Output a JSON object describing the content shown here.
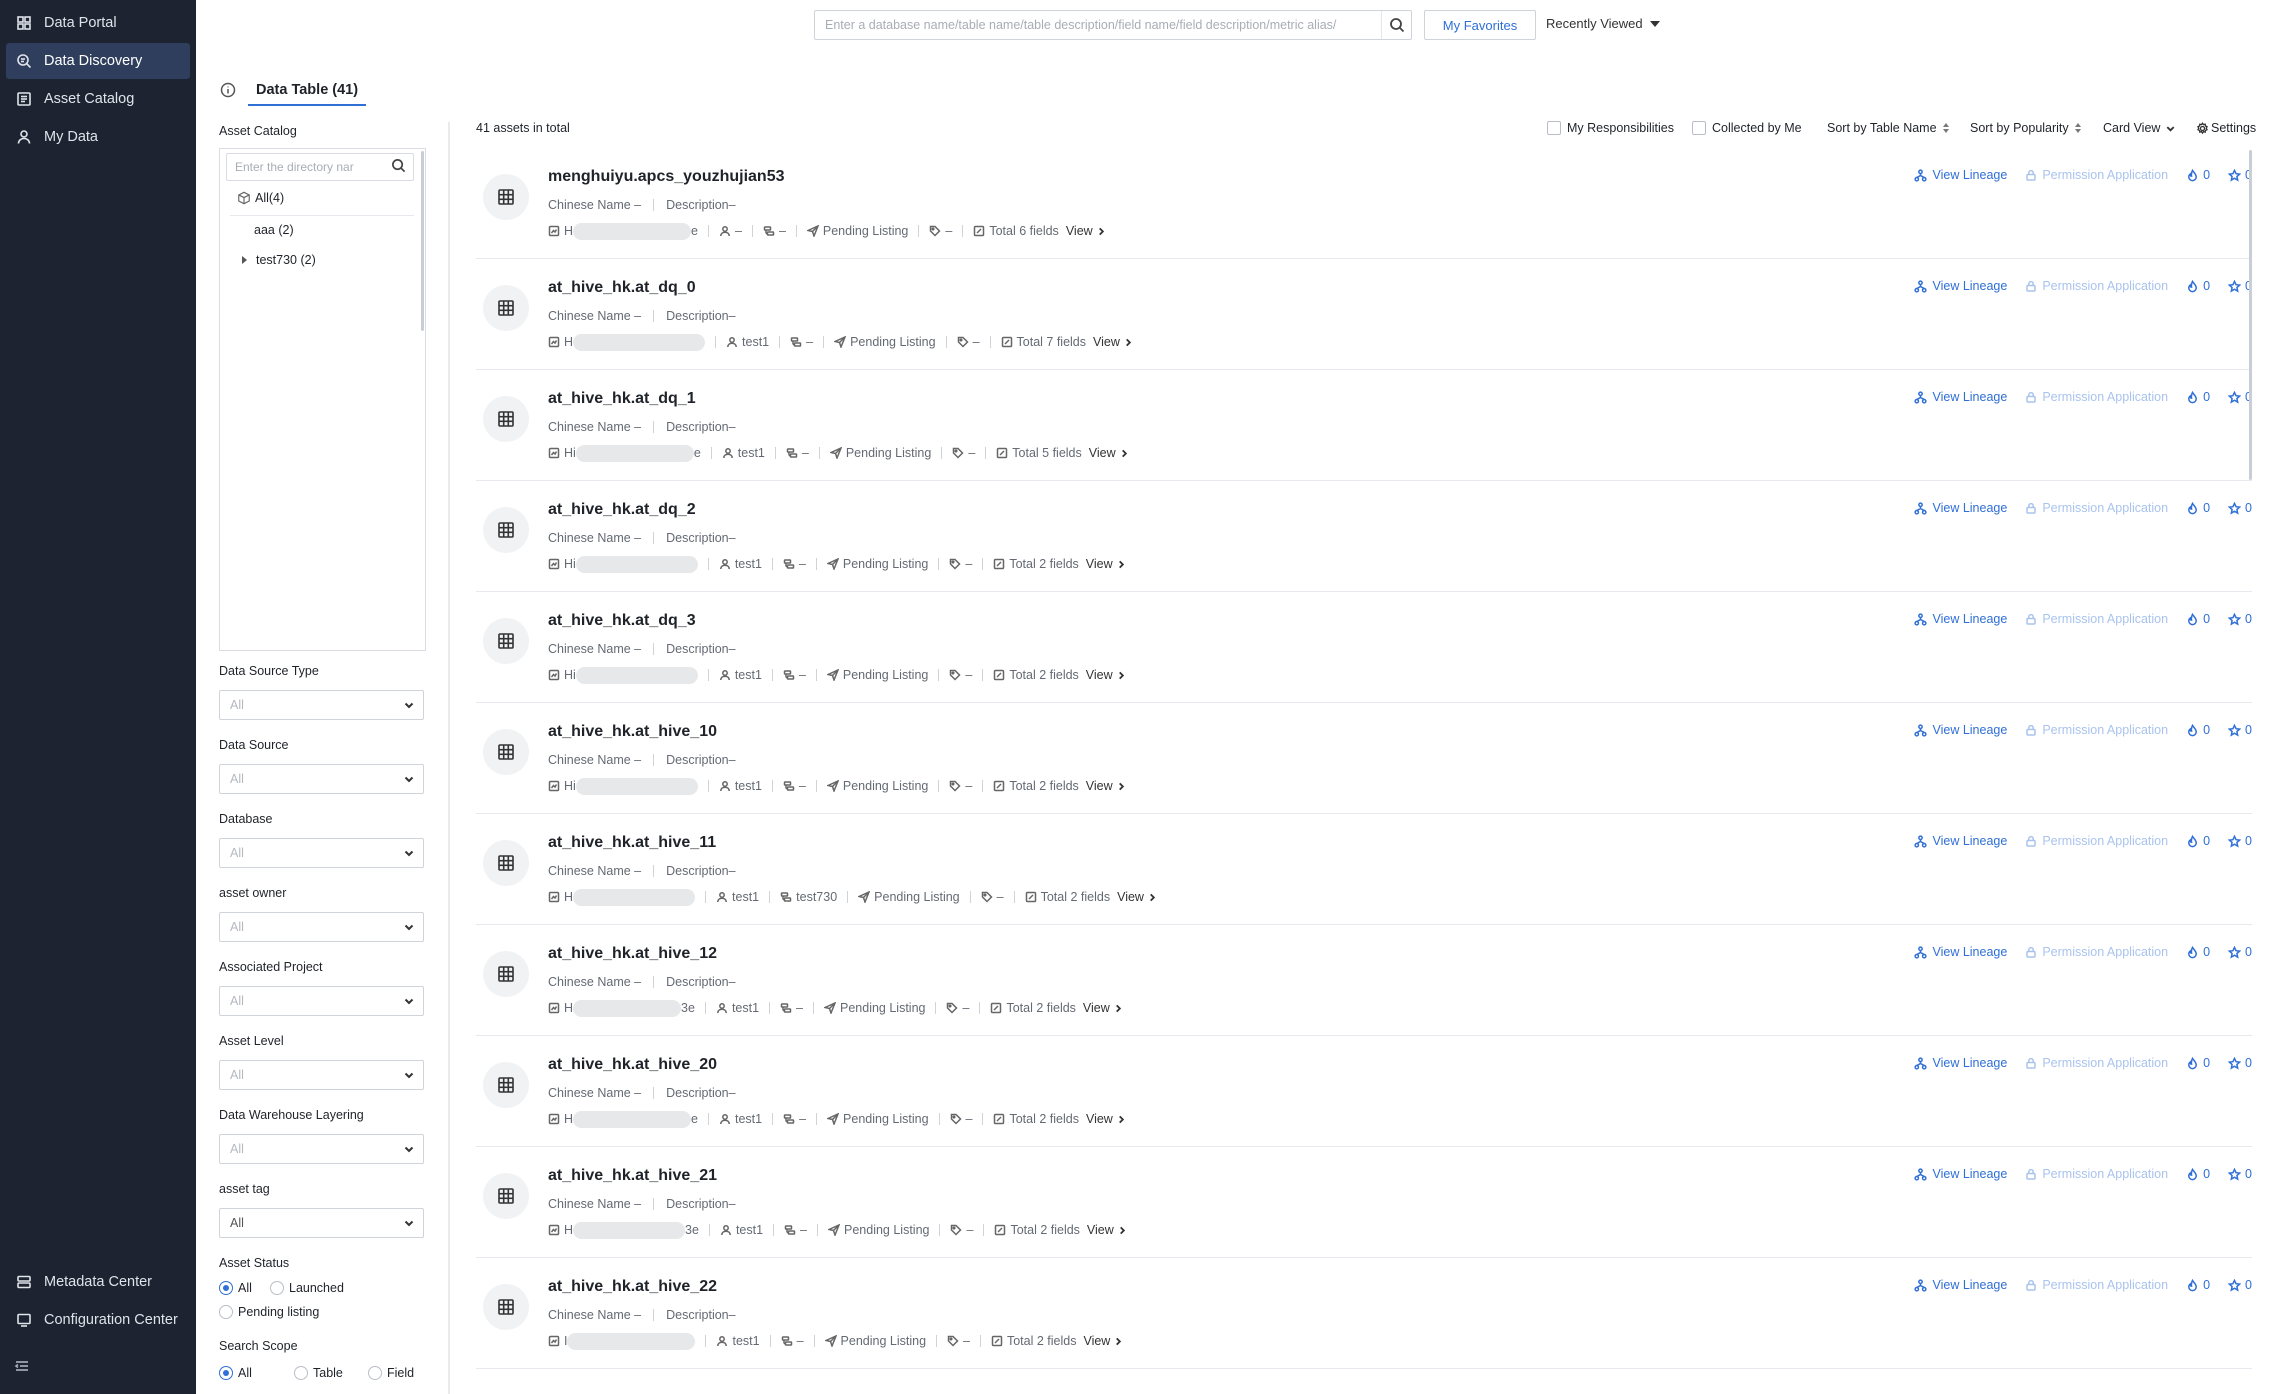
{
  "nav": {
    "top_items": [
      {
        "label": "Data Portal",
        "icon": "grid-icon"
      },
      {
        "label": "Data Discovery",
        "icon": "search-doc-icon",
        "active": true
      },
      {
        "label": "Asset Catalog",
        "icon": "catalog-icon"
      },
      {
        "label": "My Data",
        "icon": "user-icon"
      }
    ],
    "bottom_items": [
      {
        "label": "Metadata Center",
        "icon": "database-icon"
      },
      {
        "label": "Configuration Center",
        "icon": "config-icon"
      }
    ]
  },
  "header": {
    "search_placeholder": "Enter a database name/table name/table description/field name/field description/metric alias/",
    "favorites_label": "My Favorites",
    "recent_label": "Recently Viewed"
  },
  "tabs": {
    "active_label": "Data Table (41)"
  },
  "filters": {
    "asset_catalog_label": "Asset Catalog",
    "tree_search_placeholder": "Enter the directory nar",
    "tree": {
      "all": "All(4)",
      "aaa": "aaa (2)",
      "test730": "test730 (2)"
    },
    "dropdowns": [
      {
        "label": "Data Source Type",
        "value": "All"
      },
      {
        "label": "Data Source",
        "value": "All"
      },
      {
        "label": "Database",
        "value": "All"
      },
      {
        "label": "asset owner",
        "value": "All"
      },
      {
        "label": "Associated Project",
        "value": "All"
      },
      {
        "label": "Asset Level",
        "value": "All"
      },
      {
        "label": "Data Warehouse Layering",
        "value": "All"
      },
      {
        "label": "asset tag",
        "value": "All"
      }
    ],
    "asset_status": {
      "label": "Asset Status",
      "options": [
        "All",
        "Launched",
        "Pending listing"
      ],
      "selected": "All"
    },
    "search_scope": {
      "label": "Search Scope",
      "options": [
        "All",
        "Table",
        "Field"
      ],
      "selected": "All"
    }
  },
  "results": {
    "total_text": "41 assets in total",
    "my_responsibilities": "My Responsibilities",
    "collected_by_me": "Collected by Me",
    "sort_by_name": "Sort by Table Name",
    "sort_by_popularity": "Sort by Popularity",
    "view_mode": "Card View",
    "settings": "Settings",
    "common": {
      "chinese_name": "Chinese Name –",
      "description": "Description–",
      "status": "Pending Listing",
      "view": "View",
      "lineage": "View Lineage",
      "permission": "Permission Application",
      "likes": "0",
      "stars": "0"
    },
    "cards": [
      {
        "name": "menghuiyu.apcs_youzhujian53",
        "src_prefix": "H",
        "src_suffix": "e",
        "owner": "–",
        "project": "–",
        "tag": "–",
        "fields": "Total 6 fields"
      },
      {
        "name": "at_hive_hk.at_dq_0",
        "src_prefix": "H",
        "src_suffix": "",
        "owner": "test1",
        "project": "–",
        "tag": "–",
        "fields": "Total 7 fields"
      },
      {
        "name": "at_hive_hk.at_dq_1",
        "src_prefix": "Hi",
        "src_suffix": "e",
        "owner": "test1",
        "project": "–",
        "tag": "–",
        "fields": "Total 5 fields"
      },
      {
        "name": "at_hive_hk.at_dq_2",
        "src_prefix": "Hi",
        "src_suffix": "",
        "owner": "test1",
        "project": "–",
        "tag": "–",
        "fields": "Total 2 fields"
      },
      {
        "name": "at_hive_hk.at_dq_3",
        "src_prefix": "Hi",
        "src_suffix": "",
        "owner": "test1",
        "project": "–",
        "tag": "–",
        "fields": "Total 2 fields"
      },
      {
        "name": "at_hive_hk.at_hive_10",
        "src_prefix": "Hi",
        "src_suffix": "",
        "owner": "test1",
        "project": "–",
        "tag": "–",
        "fields": "Total 2 fields"
      },
      {
        "name": "at_hive_hk.at_hive_11",
        "src_prefix": "H",
        "src_suffix": "",
        "owner": "test1",
        "project": "test730",
        "tag": "–",
        "fields": "Total 2 fields"
      },
      {
        "name": "at_hive_hk.at_hive_12",
        "src_prefix": "H",
        "src_suffix": "3e",
        "owner": "test1",
        "project": "–",
        "tag": "–",
        "fields": "Total 2 fields"
      },
      {
        "name": "at_hive_hk.at_hive_20",
        "src_prefix": "H",
        "src_suffix": "e",
        "owner": "test1",
        "project": "–",
        "tag": "–",
        "fields": "Total 2 fields"
      },
      {
        "name": "at_hive_hk.at_hive_21",
        "src_prefix": "H",
        "src_suffix": "3e",
        "owner": "test1",
        "project": "–",
        "tag": "–",
        "fields": "Total 2 fields"
      },
      {
        "name": "at_hive_hk.at_hive_22",
        "src_prefix": "I",
        "src_suffix": "",
        "owner": "test1",
        "project": "–",
        "tag": "–",
        "fields": "Total 2 fields"
      }
    ]
  },
  "colors": {
    "accent": "#2f6fd6",
    "nav_bg": "#1d2330",
    "nav_active": "#2e3e5c"
  }
}
